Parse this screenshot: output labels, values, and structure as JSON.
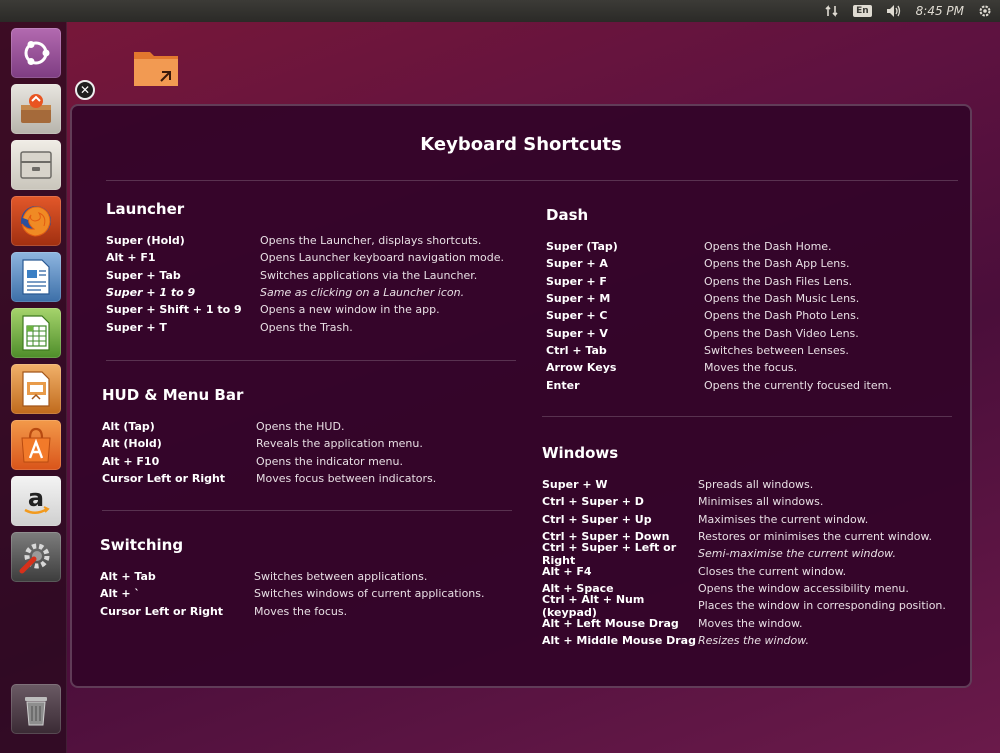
{
  "panel": {
    "keyboard_layout": "En",
    "time": "8:45 PM"
  },
  "launcher": {
    "items": [
      {
        "icon": "ubuntu-dash-icon",
        "label": "Dash"
      },
      {
        "icon": "software-updater-icon",
        "label": "Software Updater"
      },
      {
        "icon": "files-icon",
        "label": "Files"
      },
      {
        "icon": "firefox-icon",
        "label": "Firefox"
      },
      {
        "icon": "libreoffice-writer-icon",
        "label": "LibreOffice Writer"
      },
      {
        "icon": "libreoffice-calc-icon",
        "label": "LibreOffice Calc"
      },
      {
        "icon": "libreoffice-impress-icon",
        "label": "LibreOffice Impress"
      },
      {
        "icon": "ubuntu-software-center-icon",
        "label": "Ubuntu Software Center"
      },
      {
        "icon": "amazon-icon",
        "label": "Amazon"
      },
      {
        "icon": "system-settings-icon",
        "label": "System Settings"
      },
      {
        "icon": "trash-icon",
        "label": "Trash"
      }
    ]
  },
  "overlay": {
    "title": "Keyboard Shortcuts",
    "launcher": {
      "title": "Launcher",
      "rows": [
        {
          "key": "Super (Hold)",
          "desc": "Opens the Launcher, displays shortcuts."
        },
        {
          "key": "Alt + F1",
          "desc": "Opens Launcher keyboard navigation mode."
        },
        {
          "key": "Super + Tab",
          "desc": "Switches applications via the Launcher."
        },
        {
          "key": "Super + 1 to 9",
          "desc": "Same as clicking on a Launcher icon."
        },
        {
          "key": "Super + Shift + 1 to 9",
          "desc": "Opens a new window in the app."
        },
        {
          "key": "Super + T",
          "desc": "Opens the Trash."
        }
      ]
    },
    "hud": {
      "title": "HUD & Menu Bar",
      "rows": [
        {
          "key": "Alt (Tap)",
          "desc": "Opens the HUD."
        },
        {
          "key": "Alt (Hold)",
          "desc": "Reveals the application menu."
        },
        {
          "key": "Alt + F10",
          "desc": "Opens the indicator menu."
        },
        {
          "key": "Cursor Left or Right",
          "desc": "Moves focus between indicators."
        }
      ]
    },
    "switching": {
      "title": "Switching",
      "rows": [
        {
          "key": "Alt + Tab",
          "desc": "Switches between applications."
        },
        {
          "key": "Alt + `",
          "desc": "Switches windows of current applications."
        },
        {
          "key": "Cursor Left or Right",
          "desc": "Moves the focus."
        }
      ]
    },
    "dash": {
      "title": "Dash",
      "rows": [
        {
          "key": "Super (Tap)",
          "desc": "Opens the Dash Home."
        },
        {
          "key": "Super + A",
          "desc": "Opens the Dash App Lens."
        },
        {
          "key": "Super + F",
          "desc": "Opens the Dash Files Lens."
        },
        {
          "key": "Super + M",
          "desc": "Opens the Dash Music Lens."
        },
        {
          "key": "Super + C",
          "desc": "Opens the Dash Photo Lens."
        },
        {
          "key": "Super + V",
          "desc": "Opens the Dash Video Lens."
        },
        {
          "key": "Ctrl + Tab",
          "desc": "Switches between Lenses."
        },
        {
          "key": "Arrow Keys",
          "desc": "Moves the focus."
        },
        {
          "key": "Enter",
          "desc": "Opens the currently focused item."
        }
      ]
    },
    "windows": {
      "title": "Windows",
      "rows": [
        {
          "key": "Super + W",
          "desc": "Spreads all windows."
        },
        {
          "key": "Ctrl + Super + D",
          "desc": "Minimises all windows."
        },
        {
          "key": "Ctrl + Super + Up",
          "desc": "Maximises the current window."
        },
        {
          "key": "Ctrl + Super + Down",
          "desc": "Restores or minimises the current window."
        },
        {
          "key": "Ctrl + Super + Left or Right",
          "desc": "Semi-maximise the current window."
        },
        {
          "key": "Alt + F4",
          "desc": "Closes the current window."
        },
        {
          "key": "Alt + Space",
          "desc": "Opens the window accessibility menu."
        },
        {
          "key": "Ctrl + Alt + Num (keypad)",
          "desc": "Places the window in corresponding position."
        },
        {
          "key": "Alt + Left Mouse Drag",
          "desc": "Moves the window."
        },
        {
          "key": "Alt + Middle Mouse Drag",
          "desc": "Resizes the window."
        }
      ]
    }
  }
}
